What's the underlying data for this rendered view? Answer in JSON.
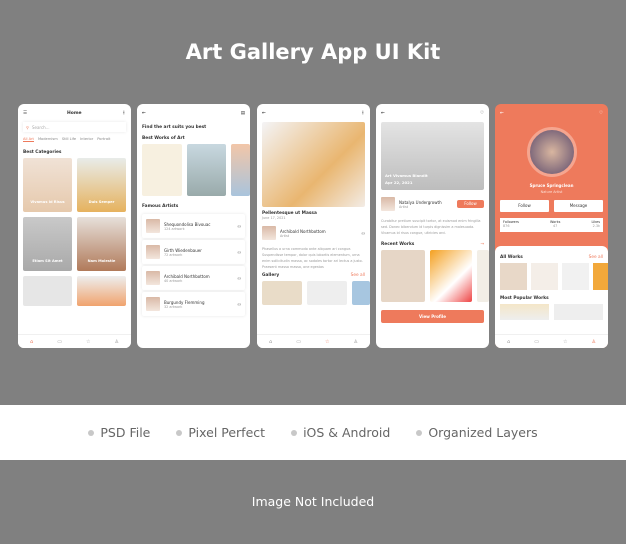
{
  "title": "Art Gallery App UI Kit",
  "features": [
    "PSD File",
    "Pixel Perfect",
    "iOS & Android",
    "Organized Layers"
  ],
  "footer": "Image Not Included",
  "accent": "#ee7a5c",
  "screen1": {
    "header": "Home",
    "search_placeholder": "Search...",
    "tabs": [
      "All Art",
      "Modernism",
      "Still Life",
      "Interior",
      "Portrait"
    ],
    "section": "Best Categories",
    "categories": [
      "Vivamus id Risus",
      "Duis Semper",
      "Etiam Sit Amet",
      "Nam Molestie"
    ]
  },
  "screen2": {
    "heading": "Find the art suits you best",
    "best_works": "Best Works of Art",
    "famous": "Famous Artists",
    "artists": [
      {
        "name": "Shequondolisa Bivouac",
        "count": "124 artwork"
      },
      {
        "name": "Girth Wiedenbauer",
        "count": "72 artwork"
      },
      {
        "name": "Archibald Northbottom",
        "count": "40 artwork"
      },
      {
        "name": "Burgundy Flemming",
        "count": "32 artwork"
      }
    ]
  },
  "screen3": {
    "art_title": "Pellentesque ut Massa",
    "date": "June 17, 2021",
    "artist": "Archibald Northbottom",
    "role": "Artist",
    "description": "Phasellus a urna commodo ante aliquam ari congue. Suspendisse tempor, dolor quis lobortis elementum, urna enim sollicitudin massa, ac sodales tortor ari lectus a justo. Praesent massa massa, one egestas",
    "gallery": "Gallery",
    "see_all": "See all"
  },
  "screen4": {
    "hero_title": "Art Vivamus Blandit",
    "hero_date": "Apr 22, 2021",
    "artist": "Natalya Undergrowth",
    "role": "Artist",
    "follow": "Follow",
    "description": "Curabitur pretium suscipit tortor, at euismod enim fringilla sed. Donec bibendum id turpis dignissim a malesuada. Vivamus id risus congue, ultricies arci.",
    "recent": "Recent Works",
    "view_profile": "View Profile"
  },
  "screen5": {
    "name": "Spruce Springclean",
    "role": "Nature Artist",
    "follow": "Follow",
    "message": "Message",
    "stats": [
      {
        "label": "Followers",
        "value": "876"
      },
      {
        "label": "Works",
        "value": "47"
      },
      {
        "label": "Likes",
        "value": "2.3k"
      }
    ],
    "all_works": "All Works",
    "see_all": "See all",
    "popular": "Most Popular Works"
  }
}
